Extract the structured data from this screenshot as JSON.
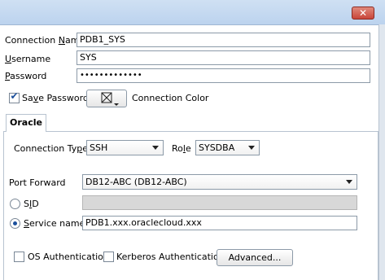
{
  "window": {
    "close_glyph": "✕"
  },
  "connection": {
    "name_label_pre": "Connection ",
    "name_label_u": "N",
    "name_label_post": "ame",
    "name_value": "PDB1_SYS",
    "username_label_u": "U",
    "username_label_post": "sername",
    "username_value": "SYS",
    "password_label_u": "P",
    "password_label_post": "assword",
    "password_value": "•••••••••••••",
    "save_password_pre": "Sa",
    "save_password_u": "v",
    "save_password_post": "e Password",
    "save_password_checked": true,
    "color_label": "Connection Color"
  },
  "tabs": [
    {
      "label": "Oracle"
    }
  ],
  "oracle": {
    "connection_type_label_pre": "Connection Ty",
    "connection_type_label_u": "p",
    "connection_type_label_post": "e",
    "connection_type_value": "SSH",
    "role_label_pre": "Ro",
    "role_label_u": "l",
    "role_label_post": "e",
    "role_value": "SYSDBA",
    "port_forward_label": "Port Forward",
    "port_forward_value": "DB12-ABC (DB12-ABC)",
    "sid_label_pre": "S",
    "sid_label_u": "I",
    "sid_label_post": "D",
    "sid_value": "",
    "service_name_label_u": "S",
    "service_name_label_post": "ervice name",
    "service_name_value": "PDB1.xxx.oraclecloud.xxx",
    "service_name_selected": true,
    "os_auth_label": "OS Authentication",
    "os_auth_checked": false,
    "kerberos_auth_label": "Kerberos Authentication",
    "kerberos_auth_checked": false,
    "advanced_button_label": "Advanced..."
  }
}
